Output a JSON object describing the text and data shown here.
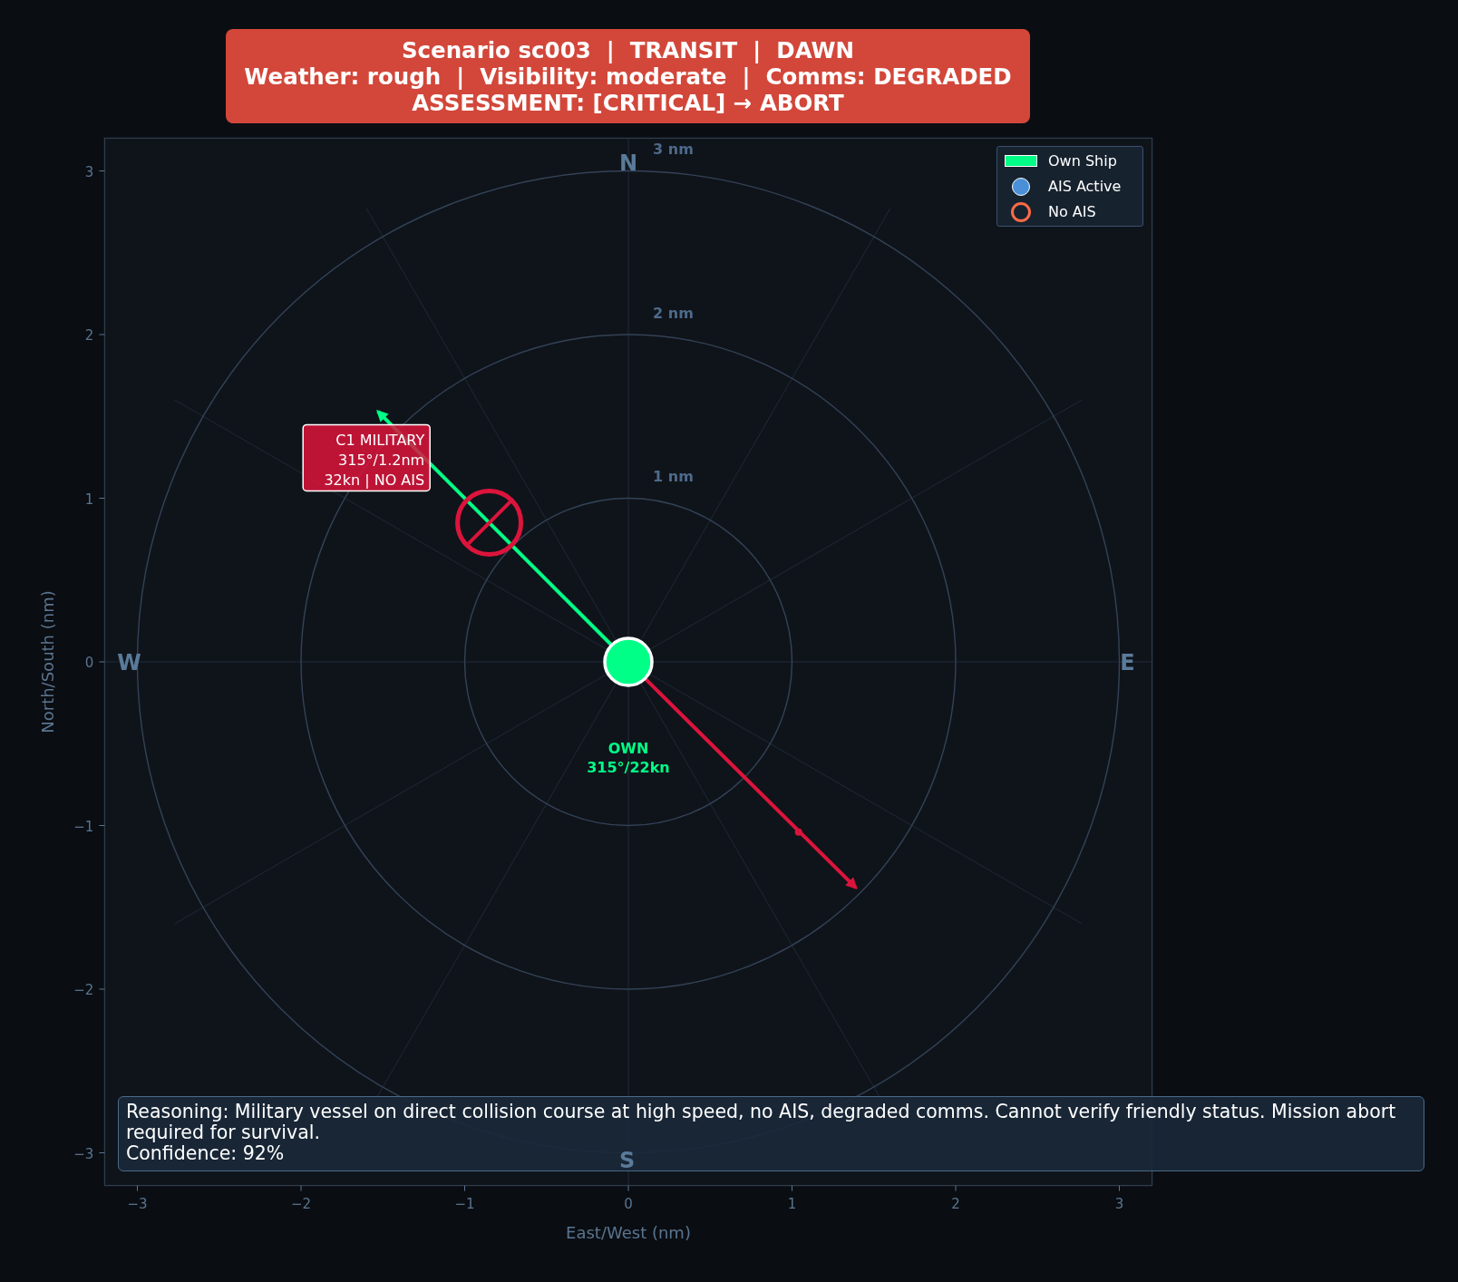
{
  "title_box": {
    "lines": [
      "Scenario sc003  |  TRANSIT  |  DAWN",
      "Weather: rough  |  Visibility: moderate  |  Comms: DEGRADED",
      "ASSESSMENT: [CRITICAL] → ABORT"
    ]
  },
  "axes": {
    "xlabel": "East/West (nm)",
    "ylabel": "North/South (nm)",
    "xticks": [
      "−3",
      "−2",
      "−1",
      "0",
      "1",
      "2",
      "3"
    ],
    "yticks": [
      "3",
      "2",
      "1",
      "0",
      "−1",
      "−2",
      "−3"
    ]
  },
  "range_rings": [
    {
      "label": "3 nm"
    },
    {
      "label": "2 nm"
    },
    {
      "label": "1 nm"
    }
  ],
  "compass": [
    {
      "label": "N"
    },
    {
      "label": "E"
    },
    {
      "label": "S"
    },
    {
      "label": "W"
    }
  ],
  "own_ship": {
    "label_lines": [
      "OWN",
      "315°/22kn"
    ]
  },
  "contact": {
    "label_lines": [
      "C1 MILITARY",
      "315°/1.2nm",
      "32kn | NO AIS"
    ],
    "ais": false
  },
  "legend": [
    {
      "kind": "patch",
      "label": "Own Ship",
      "color": "#00ff87"
    },
    {
      "kind": "dot",
      "label": "AIS Active",
      "color": "#4a90d9"
    },
    {
      "kind": "ring",
      "label": "No AIS",
      "color": "#ff6b47"
    }
  ],
  "reasoning": {
    "lines": [
      "Reasoning: Military vessel on direct collision course at high speed, no AIS, degraded comms. Cannot verify friendly status. Mission abort",
      "required for survival.",
      "Confidence: 92%"
    ]
  }
}
